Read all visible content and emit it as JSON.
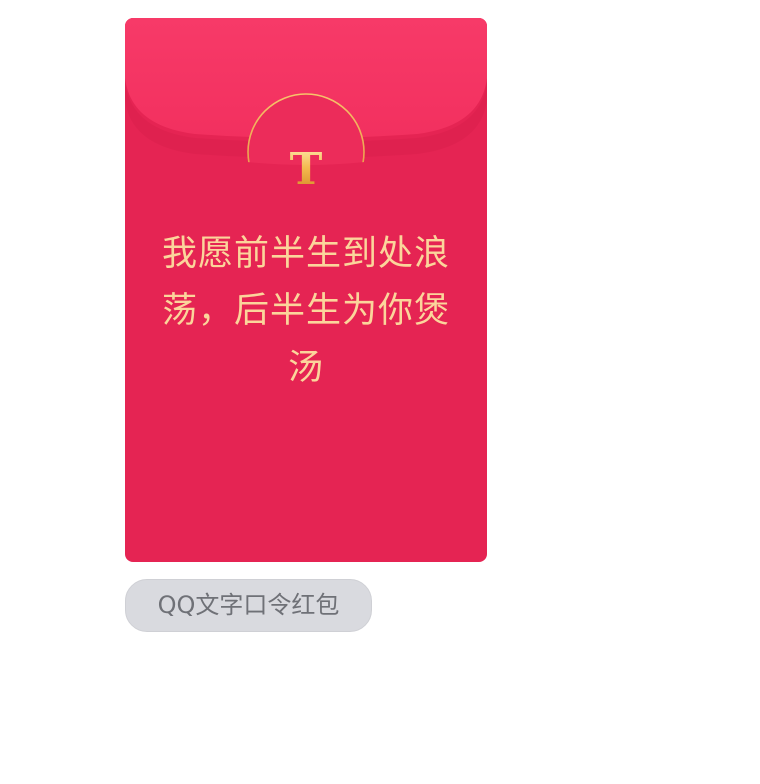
{
  "red_packet": {
    "seal_icon": "T-letter-seal-icon",
    "message": "我愿前半生到处浪荡，后半生为你煲汤",
    "type_label": "QQ文字口令红包"
  },
  "colors": {
    "envelope_body": "#e52453",
    "envelope_flap": "#f53565",
    "seal_gold": "#f4b94f",
    "message_text": "#fbd59b",
    "tag_background": "#d9dadf",
    "tag_text": "#6f7177"
  }
}
